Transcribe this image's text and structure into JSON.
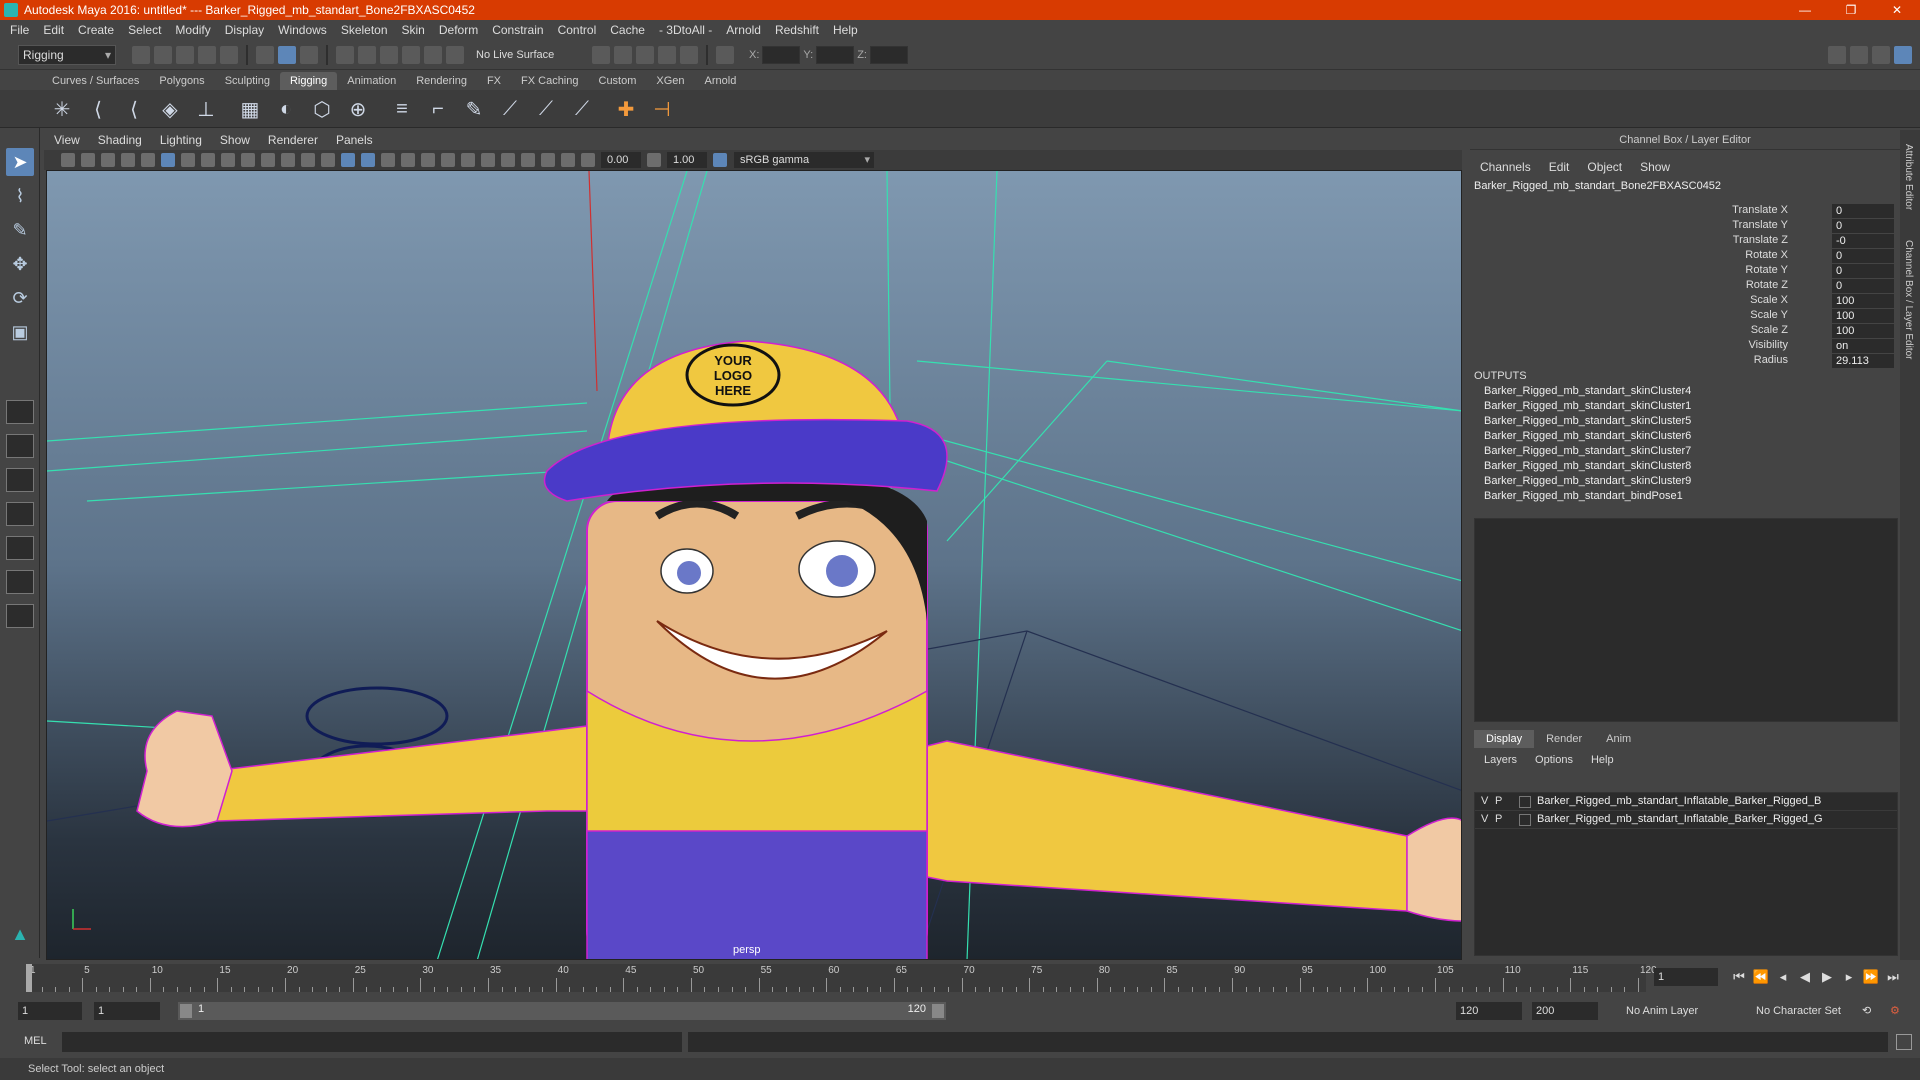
{
  "window": {
    "title": "Autodesk Maya 2016: untitled*   ---   Barker_Rigged_mb_standart_Bone2FBXASC0452",
    "controls": [
      "—",
      "❐",
      "✕"
    ]
  },
  "menubar": [
    "File",
    "Edit",
    "Create",
    "Select",
    "Modify",
    "Display",
    "Windows",
    "Skeleton",
    "Skin",
    "Deform",
    "Constrain",
    "Control",
    "Cache",
    "- 3DtoAll -",
    "Arnold",
    "Redshift",
    "Help"
  ],
  "statusline": {
    "mode": "Rigging",
    "live_surface": "No Live Surface",
    "x_label": "X:",
    "y_label": "Y:",
    "z_label": "Z:"
  },
  "shelf_tabs": [
    "Curves / Surfaces",
    "Polygons",
    "Sculpting",
    "Rigging",
    "Animation",
    "Rendering",
    "FX",
    "FX Caching",
    "Custom",
    "XGen",
    "Arnold"
  ],
  "shelf_active": "Rigging",
  "panel_menu": [
    "View",
    "Shading",
    "Lighting",
    "Show",
    "Renderer",
    "Panels"
  ],
  "panel_toolbar": {
    "exposure": "0.00",
    "gamma": "1.00",
    "color_space": "sRGB gamma"
  },
  "viewport": {
    "camera": "persp",
    "logo_text": [
      "YOUR",
      "LOGO",
      "HERE"
    ]
  },
  "channel_box": {
    "title": "Channel Box / Layer Editor",
    "menu": [
      "Channels",
      "Edit",
      "Object",
      "Show"
    ],
    "object": "Barker_Rigged_mb_standart_Bone2FBXASC0452",
    "channels": [
      {
        "label": "Translate X",
        "value": "0"
      },
      {
        "label": "Translate Y",
        "value": "0"
      },
      {
        "label": "Translate Z",
        "value": "-0"
      },
      {
        "label": "Rotate X",
        "value": "0"
      },
      {
        "label": "Rotate Y",
        "value": "0"
      },
      {
        "label": "Rotate Z",
        "value": "0"
      },
      {
        "label": "Scale X",
        "value": "100"
      },
      {
        "label": "Scale Y",
        "value": "100"
      },
      {
        "label": "Scale Z",
        "value": "100"
      },
      {
        "label": "Visibility",
        "value": "on"
      },
      {
        "label": "Radius",
        "value": "29.113"
      }
    ],
    "outputs_header": "OUTPUTS",
    "outputs": [
      "Barker_Rigged_mb_standart_skinCluster4",
      "Barker_Rigged_mb_standart_skinCluster1",
      "Barker_Rigged_mb_standart_skinCluster5",
      "Barker_Rigged_mb_standart_skinCluster6",
      "Barker_Rigged_mb_standart_skinCluster7",
      "Barker_Rigged_mb_standart_skinCluster8",
      "Barker_Rigged_mb_standart_skinCluster9",
      "Barker_Rigged_mb_standart_bindPose1"
    ]
  },
  "layer_editor": {
    "tabs": [
      "Display",
      "Render",
      "Anim"
    ],
    "menu": [
      "Layers",
      "Options",
      "Help"
    ],
    "layers": [
      {
        "v": "V",
        "p": "P",
        "name": "Barker_Rigged_mb_standart_Inflatable_Barker_Rigged_B"
      },
      {
        "v": "V",
        "p": "P",
        "name": "Barker_Rigged_mb_standart_Inflatable_Barker_Rigged_G"
      }
    ]
  },
  "side_tabs": [
    "Attribute Editor",
    "Channel Box / Layer Editor"
  ],
  "timeslider": {
    "ticks": [
      "1",
      "5",
      "10",
      "15",
      "20",
      "25",
      "30",
      "35",
      "40",
      "45",
      "50",
      "55",
      "60",
      "65",
      "70",
      "75",
      "80",
      "85",
      "90",
      "95",
      "100",
      "105",
      "110",
      "115",
      "120"
    ],
    "current_frame": "1"
  },
  "range": {
    "start": "1",
    "playback_start": "1",
    "slider_start": "1",
    "slider_end": "120",
    "playback_end": "120",
    "end": "200",
    "anim_layer": "No Anim Layer",
    "character_set": "No Character Set"
  },
  "commandline": {
    "language": "MEL"
  },
  "helpline": "Select Tool: select an object"
}
